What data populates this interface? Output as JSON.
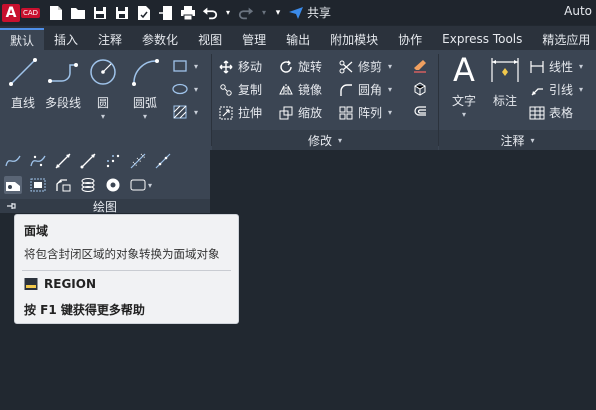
{
  "app": {
    "logo_letter": "A",
    "logo_badge": "CAD",
    "share_label": "共享",
    "title_truncated": "Auto"
  },
  "tabs": [
    {
      "label": "默认",
      "active": true
    },
    {
      "label": "插入"
    },
    {
      "label": "注释"
    },
    {
      "label": "参数化"
    },
    {
      "label": "视图"
    },
    {
      "label": "管理"
    },
    {
      "label": "输出"
    },
    {
      "label": "附加模块"
    },
    {
      "label": "协作"
    },
    {
      "label": "Express Tools"
    },
    {
      "label": "精选应用"
    }
  ],
  "draw_panel": {
    "line": "直线",
    "polyline": "多段线",
    "circle": "圆",
    "arc": "圆弧",
    "title": "绘图"
  },
  "modify_panel": {
    "move": "移动",
    "rotate": "旋转",
    "trim": "修剪",
    "copy": "复制",
    "mirror": "镜像",
    "fillet": "圆角",
    "stretch": "拉伸",
    "scale": "缩放",
    "array": "阵列",
    "title": "修改"
  },
  "annotation_panel": {
    "text": "文字",
    "dimension": "标注",
    "linear": "线性",
    "leader": "引线",
    "table": "表格",
    "title": "注释"
  },
  "tooltip": {
    "title": "面域",
    "description": "将包含封闭区域的对象转换为面域对象",
    "command": "REGION",
    "help": "按 F1 键获得更多帮助"
  }
}
